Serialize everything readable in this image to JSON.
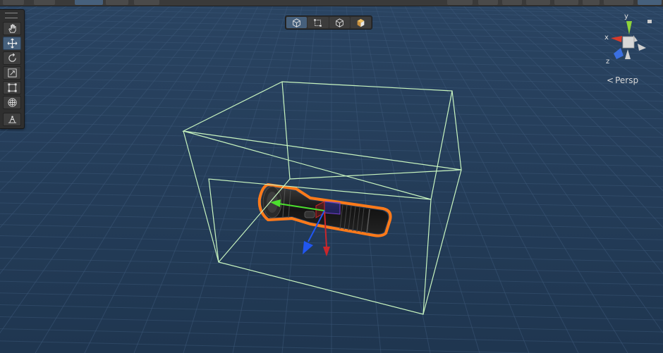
{
  "viewport": {
    "projection_label": "Persp",
    "projection_chevron": "<",
    "background_color": "#233a56",
    "grid_color": "#3c5878"
  },
  "gizmo": {
    "axes": [
      "y",
      "x",
      "z"
    ],
    "colors": {
      "x": "#d63b2b",
      "y": "#8ed43b",
      "z": "#3b6fe0",
      "center": "#d0d0d0"
    }
  },
  "toolbox": {
    "tools": [
      {
        "name": "hand-tool",
        "icon": "hand-icon",
        "active": false
      },
      {
        "name": "move-tool",
        "icon": "move-icon",
        "active": true
      },
      {
        "name": "rotate-tool",
        "icon": "rotate-icon",
        "active": false
      },
      {
        "name": "scale-tool",
        "icon": "scale-icon",
        "active": false
      },
      {
        "name": "rect-tool",
        "icon": "rect-tool-icon",
        "active": false
      },
      {
        "name": "transform-tool",
        "icon": "transform-icon",
        "active": false
      },
      {
        "name": "custom-tool",
        "icon": "custom-editor-tool-icon",
        "active": false
      }
    ]
  },
  "view_options": {
    "buttons": [
      {
        "icon": "wireframe-cube-icon",
        "active": true
      },
      {
        "icon": "bounds-icon",
        "active": false
      },
      {
        "icon": "shaded-cube-icon",
        "active": false
      },
      {
        "icon": "lit-cube-icon",
        "active": false
      }
    ]
  },
  "selection": {
    "outline_color": "#ff7a1a",
    "bounds_color": "#c8f5c0",
    "handle_colors": {
      "x": "#c9262b",
      "y": "#4ce02e",
      "z": "#2156f0"
    }
  }
}
